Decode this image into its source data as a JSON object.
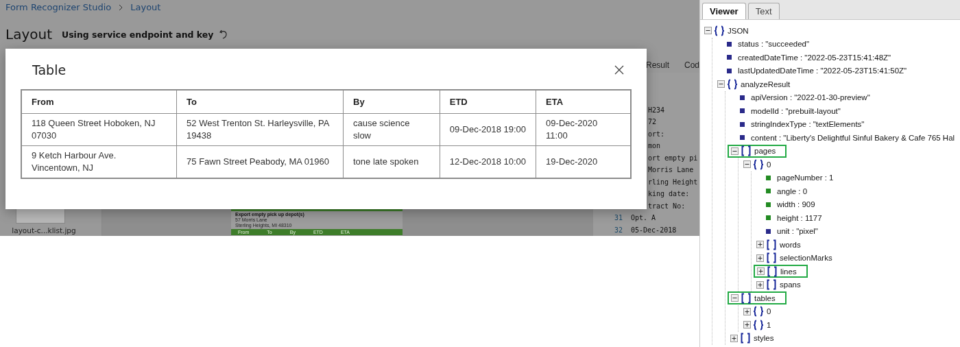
{
  "studio": {
    "breadcrumb": [
      "Form Recognizer Studio",
      "Layout"
    ],
    "title": "Layout",
    "subtitle": "Using service endpoint and key",
    "result_tabs": [
      "Result",
      "Cod"
    ],
    "thumbnail": {
      "caption": "layout-c...klist.jpg"
    },
    "document": {
      "lines": [
        "Export empty pick up depot(s)",
        "57 Morris Lane",
        "Sterling Heights, MI 48310"
      ],
      "header": [
        "From",
        "To",
        "By",
        "ETD",
        "ETA"
      ]
    },
    "code_lines": [
      {
        "text": "H234"
      },
      {
        "text": "72"
      },
      {
        "text": "ort:"
      },
      {
        "text": "mon"
      },
      {
        "text": "ort empty pi"
      },
      {
        "text": "Morris Lane"
      },
      {
        "text": "rling Height"
      },
      {
        "text": "king date:"
      },
      {
        "text": "tract No:"
      },
      {
        "number": "31",
        "text": "Opt. A"
      },
      {
        "number": "32",
        "text": "05-Dec-2018"
      }
    ]
  },
  "dialog": {
    "title": "Table",
    "columns": [
      "From",
      "To",
      "By",
      "ETD",
      "ETA"
    ],
    "rows": [
      [
        "118 Queen Street Hoboken, NJ 07030",
        "52 West Trenton St. Harleysville, PA 19438",
        "cause science slow",
        "09-Dec-2018 19:00",
        "09-Dec-2020 11:00"
      ],
      [
        "9 Ketch Harbour Ave. Vincentown, NJ",
        "75 Fawn Street Peabody, MA 01960",
        "tone late spoken",
        "12-Dec-2018 10:00",
        "19-Dec-2020"
      ]
    ]
  },
  "viewer": {
    "tabs": [
      {
        "label": "Viewer",
        "selected": true
      },
      {
        "label": "Text",
        "selected": false
      }
    ],
    "tree": {
      "label": "JSON",
      "kind": "object",
      "expanded": true,
      "highlighted": false,
      "children": [
        {
          "label": "status : \"succeeded\"",
          "kind": "string"
        },
        {
          "label": "createdDateTime : \"2022-05-23T15:41:48Z\"",
          "kind": "string"
        },
        {
          "label": "lastUpdatedDateTime : \"2022-05-23T15:41:50Z\"",
          "kind": "string"
        },
        {
          "label": "analyzeResult",
          "kind": "object",
          "expanded": true,
          "highlighted": false,
          "children": [
            {
              "label": "apiVersion : \"2022-01-30-preview\"",
              "kind": "string"
            },
            {
              "label": "modelId : \"prebuilt-layout\"",
              "kind": "string"
            },
            {
              "label": "stringIndexType : \"textElements\"",
              "kind": "string"
            },
            {
              "label": "content : \"Liberty's Delightful Sinful Bakery & Cafe 765 Hal",
              "kind": "string"
            },
            {
              "label": "pages",
              "kind": "array",
              "expanded": true,
              "highlighted": true,
              "children": [
                {
                  "label": "0",
                  "kind": "object",
                  "expanded": true,
                  "highlighted": false,
                  "children": [
                    {
                      "label": "pageNumber : 1",
                      "kind": "number"
                    },
                    {
                      "label": "angle : 0",
                      "kind": "number"
                    },
                    {
                      "label": "width : 909",
                      "kind": "number"
                    },
                    {
                      "label": "height : 1177",
                      "kind": "number"
                    },
                    {
                      "label": "unit : \"pixel\"",
                      "kind": "string"
                    },
                    {
                      "label": "words",
                      "kind": "array",
                      "expanded": false,
                      "highlighted": false
                    },
                    {
                      "label": "selectionMarks",
                      "kind": "array",
                      "expanded": false,
                      "highlighted": false
                    },
                    {
                      "label": "lines",
                      "kind": "array",
                      "expanded": false,
                      "highlighted": true
                    },
                    {
                      "label": "spans",
                      "kind": "array",
                      "expanded": false,
                      "highlighted": false
                    }
                  ]
                }
              ]
            },
            {
              "label": "tables",
              "kind": "array",
              "expanded": true,
              "highlighted": true,
              "children": [
                {
                  "label": "0",
                  "kind": "object",
                  "expanded": false,
                  "highlighted": false
                },
                {
                  "label": "1",
                  "kind": "object",
                  "expanded": false,
                  "highlighted": false
                }
              ]
            },
            {
              "label": "styles",
              "kind": "array",
              "expanded": false,
              "highlighted": false
            }
          ]
        }
      ]
    }
  }
}
